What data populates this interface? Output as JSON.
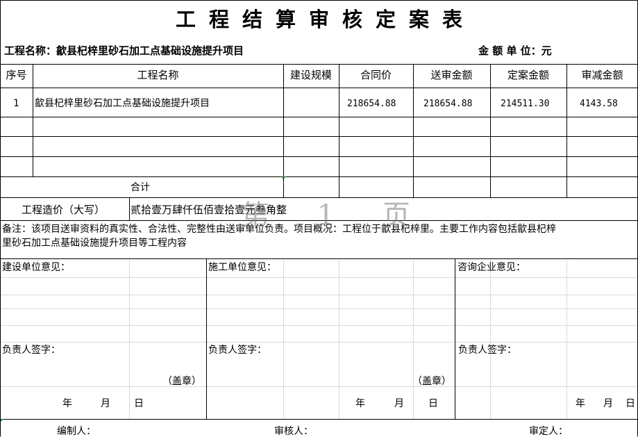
{
  "document": {
    "title": "工程结算审核定案表",
    "project_label": "工程名称：歙县杞梓里砂石加工点基础设施提升项目",
    "unit_label": "金 额 单 位：元"
  },
  "table": {
    "headers": [
      "序号",
      "工程名称",
      "建设规模",
      "合同价",
      "送审金额",
      "定案金额",
      "审减金额"
    ],
    "rows": [
      {
        "no": "1",
        "name": "歙县杞梓里砂石加工点基础设施提升项目",
        "scale": "",
        "contract": "218654.88",
        "submitted": "218654.88",
        "approved": "214511.30",
        "reduced": "4143.58"
      }
    ],
    "total_label": "合计"
  },
  "cost": {
    "label": "工程造价（大写）",
    "value": "贰拾壹万肆仟伍佰壹拾壹元叁角整"
  },
  "remark": {
    "line1": "备注：该项目送审资料的真实性、合法性、完整性由送审单位负责。项目概况：工程位于歙县杞梓里。主要工作内容包括歙县杞梓",
    "line2": "里砂石加工点基础设施提升项目等工程内容"
  },
  "opinions": {
    "construction_unit": "建设单位意见：",
    "contractor_unit": "施工单位意见：",
    "consulting_unit": "咨询企业意见：",
    "signer_label": "负责人签字：",
    "seal_label": "（盖章）",
    "year": "年",
    "month": "月",
    "day": "日"
  },
  "footer": {
    "compiler": "编制人：",
    "reviewer": "审核人：",
    "approver": "审定人："
  },
  "watermark": "第 1 页"
}
